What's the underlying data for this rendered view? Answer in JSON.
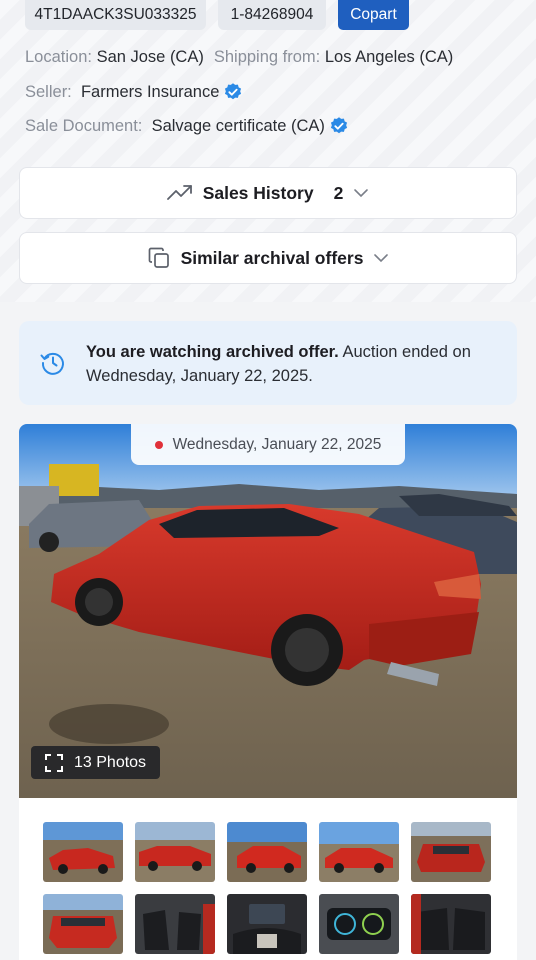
{
  "header": {
    "vin": "4T1DAACK3SU033325",
    "lot": "1-84268904",
    "auction": "Copart"
  },
  "details": {
    "location_label": "Location:",
    "location_value": "San Jose (CA)",
    "shipping_label": "Shipping from:",
    "shipping_value": "Los Angeles (CA)",
    "seller_label": "Seller:",
    "seller_value": "Farmers Insurance",
    "doc_label": "Sale Document:",
    "doc_value": "Salvage certificate (CA)"
  },
  "sales_history": {
    "label": "Sales History",
    "count": "2"
  },
  "similar": {
    "label": "Similar archival offers"
  },
  "notice": {
    "bold": "You are watching archived offer.",
    "text": " Auction ended on Wednesday, January 22, 2025."
  },
  "gallery": {
    "date": "Wednesday, January 22, 2025",
    "photos_label": "13 Photos",
    "thumbs": [
      "car-front-left",
      "car-side",
      "car-rear-right",
      "car-front-right",
      "car-front",
      "car-rear",
      "interior-front-seats",
      "dashboard-screen",
      "instrument-cluster",
      "interior-rear"
    ]
  },
  "colors": {
    "accent": "#1f5fbf",
    "verified": "#2b8ae6",
    "notice_bg": "#e8f1fb",
    "car_red": "#c8281f",
    "live_dot": "#e0313a"
  }
}
